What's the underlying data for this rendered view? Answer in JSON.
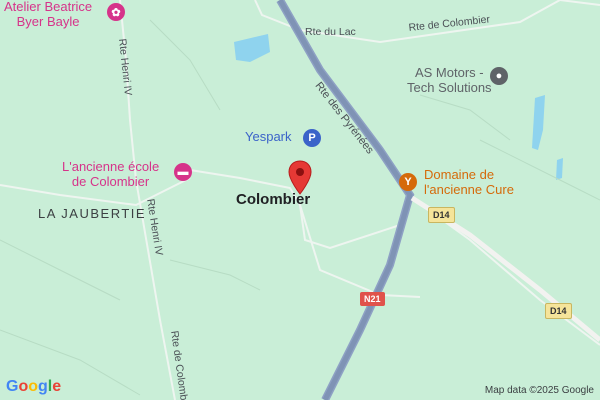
{
  "map": {
    "pois": {
      "atelier": {
        "line1": "Atelier Beatrice",
        "line2": "Byer Bayle",
        "icon": "palette-icon",
        "color": "#d6338a"
      },
      "ecole": {
        "line1": "L'ancienne école",
        "line2": "de Colombier",
        "icon": "bed-icon",
        "color": "#d6338a"
      },
      "yespark": {
        "label": "Yespark",
        "icon": "parking-icon",
        "icon_text": "P",
        "color": "#3b63c9"
      },
      "asmotors": {
        "line1": "AS Motors -",
        "line2": "Tech Solutions",
        "icon": "place-icon",
        "color": "#5f6368"
      },
      "domaine": {
        "line1": "Domaine de",
        "line2": "l'ancienne Cure",
        "icon": "wine-glass-icon",
        "color": "#d56a0a"
      }
    },
    "places": {
      "colombier": "Colombier",
      "jaubertie": "LA JAUBERTIE"
    },
    "roads": {
      "rte_du_lac": "Rte du Lac",
      "rte_de_colombier_top": "Rte de Colombier",
      "rte_des_pyrenees": "Rte des Pyrénées",
      "rte_henri_iv_1": "Rte Henri IV",
      "rte_henri_iv_2": "Rte Henri IV",
      "rte_de_colomb": "Rte de Colomb"
    },
    "shields": {
      "d14_a": "D14",
      "d14_b": "D14",
      "n21": "N21"
    },
    "logo": "Google",
    "attribution": "Map data ©2025 Google",
    "colors": {
      "land": "#c9eed7",
      "water": "#8fd3ee",
      "highway": "#7f93b5",
      "marker": "#e53935"
    }
  }
}
